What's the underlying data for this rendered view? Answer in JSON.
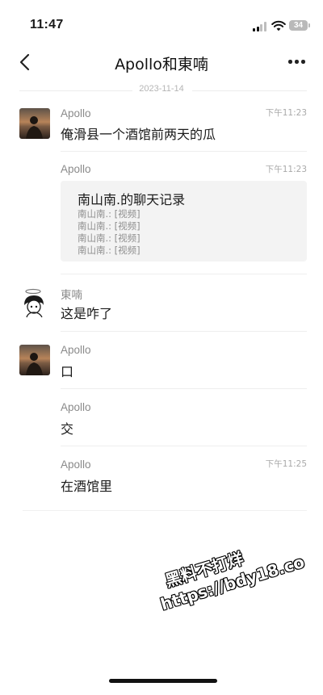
{
  "status_bar": {
    "time": "11:47",
    "battery": "34"
  },
  "header": {
    "title": "Apollo和東喃"
  },
  "date_separator": "2023-11-14",
  "messages": [
    {
      "sender": "Apollo",
      "time": "下午11:23",
      "text": "俺滑县一个酒馆前两天的瓜"
    },
    {
      "sender": "Apollo",
      "time": "下午11:23",
      "record": {
        "title": "南山南.的聊天记录",
        "lines": [
          "南山南.: [视频]",
          "南山南.: [视频]",
          "南山南.: [视频]",
          "南山南.: [视频]"
        ]
      }
    },
    {
      "sender": "東喃",
      "text": "这是咋了"
    },
    {
      "sender": "Apollo",
      "text": "口"
    },
    {
      "sender": "Apollo",
      "text": "交"
    },
    {
      "sender": "Apollo",
      "time": "下午11:25",
      "text": "在酒馆里"
    }
  ],
  "watermark": {
    "line1": "黑料不打烊",
    "line2": "https://bdy18.co"
  },
  "icons": [
    "back-icon",
    "more-icon",
    "signal-icon",
    "wifi-icon",
    "battery-icon"
  ]
}
